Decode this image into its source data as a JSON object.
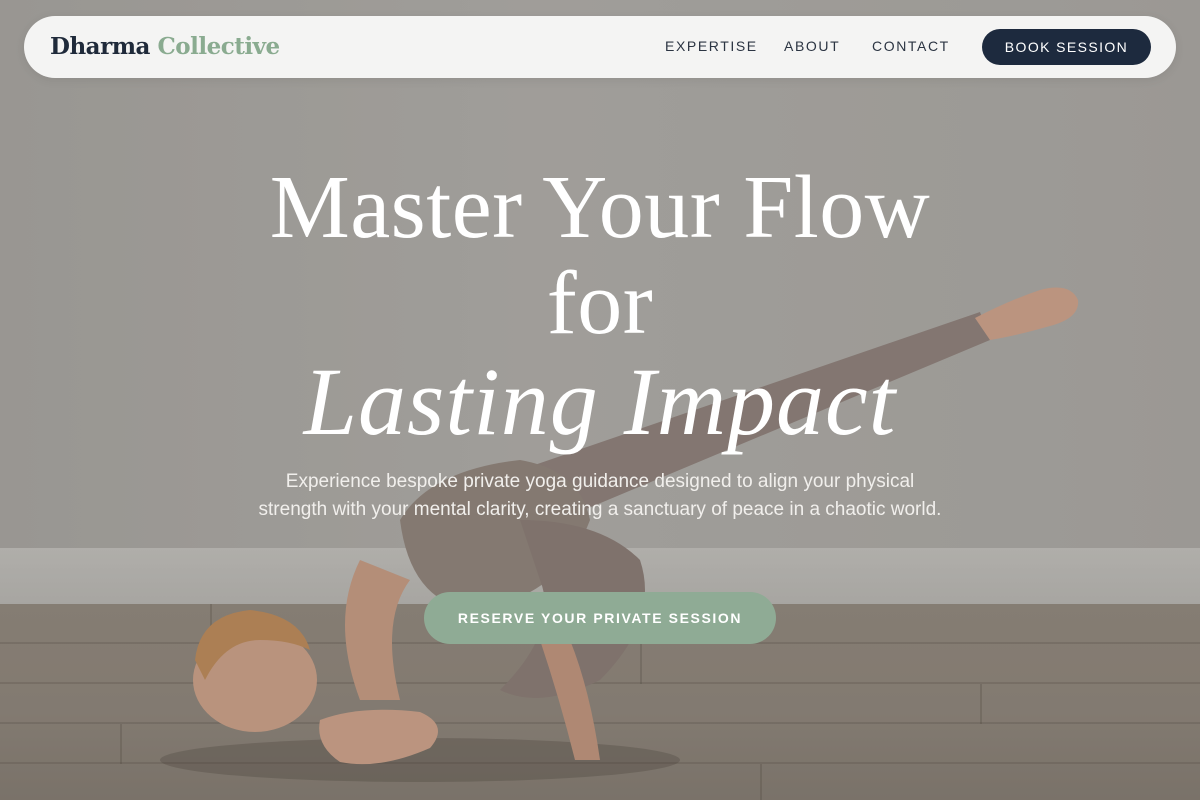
{
  "brand": {
    "name_main": "Dharma",
    "name_accent": "Collective"
  },
  "nav": {
    "links": [
      "EXPERTISE",
      "ABOUT",
      "CONTACT"
    ],
    "cta_label": "BOOK SESSION"
  },
  "hero": {
    "title_line1": "Master Your Flow",
    "title_line2": "for",
    "title_line3": "Lasting Impact",
    "subtitle": "Experience bespoke private yoga guidance designed to align your physical strength with your mental clarity, creating a sanctuary of peace in a chaotic world.",
    "cta_label": "RESERVE YOUR PRIVATE SESSION"
  },
  "colors": {
    "navy": "#1d2a3e",
    "sage": "#8fab95",
    "brand_accent": "#8aab90",
    "nav_bg": "#f4f4f3"
  },
  "background_image": {
    "subject": "woman in arm-balance yoga pose on wooden floor"
  }
}
